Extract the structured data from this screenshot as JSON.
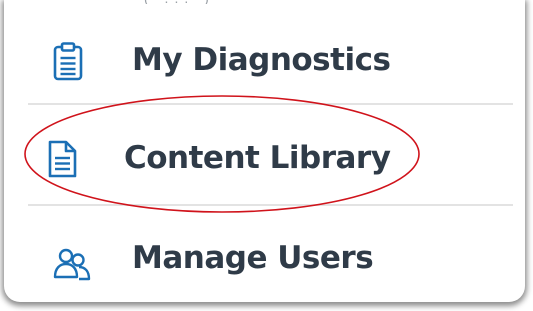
{
  "menu": {
    "partial_text": "( ... )",
    "items": [
      {
        "label": "My Diagnostics",
        "icon": "clipboard-icon"
      },
      {
        "label": "Content Library",
        "icon": "document-icon"
      },
      {
        "label": "Manage Users",
        "icon": "users-icon"
      }
    ]
  },
  "colors": {
    "icon_blue": "#1b6fb5",
    "label_text": "#2f3b48",
    "divider": "#e3e3e3",
    "highlight_red": "#d0131b"
  }
}
